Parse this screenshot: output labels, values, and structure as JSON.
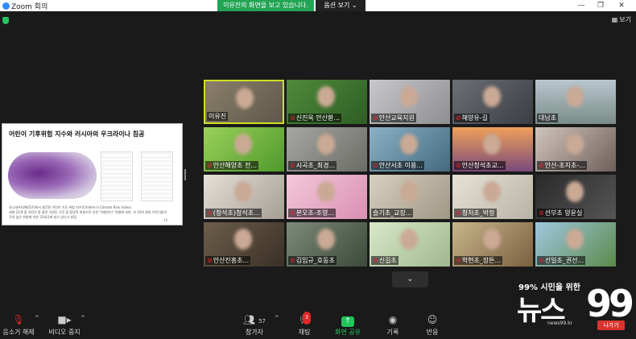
{
  "window": {
    "app_title": "Zoom 회의",
    "share_banner": "이유진의 화면을 보고 있습니다.",
    "view_options": "옵션 보기 ⌄",
    "controls": [
      "—",
      "❐",
      "✕"
    ]
  },
  "header": {
    "view_label": "보기"
  },
  "slide": {
    "title": "어린이 기후위험 지수와 러시아의 우크라이나 침공",
    "note_line1": "유니세프(UNICEF)에서 발간한 어린이 기후 위험 지수(Children's Climate Risk Index)",
    "note_line2": "세계 22개 중 어린이 중 절반 가량인 기후 및 환경적 위험으로 인한 \"위험하다\" 위험에 처한, 약 10억 명의 어린이들이 국의 높은 위험에 처한 33개국에 살고 있다고 밝힘.",
    "page": "14"
  },
  "participants": [
    {
      "name": "이유진",
      "muted": false
    },
    {
      "name": "신진옥 안산환...",
      "muted": true
    },
    {
      "name": "안산교육지원",
      "muted": true
    },
    {
      "name": "해양유-길",
      "muted": true
    },
    {
      "name": "대남초",
      "muted": false
    },
    {
      "name": "안산해양초 전...",
      "muted": true
    },
    {
      "name": "시곡초_최경...",
      "muted": true
    },
    {
      "name": "안산서초 이용...",
      "muted": true
    },
    {
      "name": "안산청석초교...",
      "muted": true
    },
    {
      "name": "안산-초지초-...",
      "muted": true
    },
    {
      "name": "(청석초)청석초...",
      "muted": true
    },
    {
      "name": "본오초-조영...",
      "muted": true
    },
    {
      "name": "슬기초_교장...",
      "muted": false
    },
    {
      "name": "청처초_박정",
      "muted": true
    },
    {
      "name": "선부초 양윤실",
      "muted": true
    },
    {
      "name": "안산진흥초...",
      "muted": true
    },
    {
      "name": "김임규_호동초",
      "muted": true
    },
    {
      "name": "신길초",
      "muted": true
    },
    {
      "name": "학현초_장튼...",
      "muted": true
    },
    {
      "name": "선일초_권선...",
      "muted": true
    }
  ],
  "toolbar": {
    "mute_label": "음소거 해제",
    "video_label": "비디오 중지",
    "participants_label": "참가자",
    "participants_count": "57",
    "chat_label": "채팅",
    "chat_badge": "3",
    "share_label": "화면 공유",
    "record_label": "기록",
    "reactions_label": "반응",
    "exit_label": "나가기"
  },
  "watermark": {
    "tagline": "99% 시민을 위한",
    "brand": "뉴스",
    "number": "99",
    "url": "news99.kr"
  },
  "colors": {
    "share_green": "#23a455",
    "active_speaker": "#cde024",
    "exit_red": "#d9352e",
    "muted_red": "#e02828"
  }
}
